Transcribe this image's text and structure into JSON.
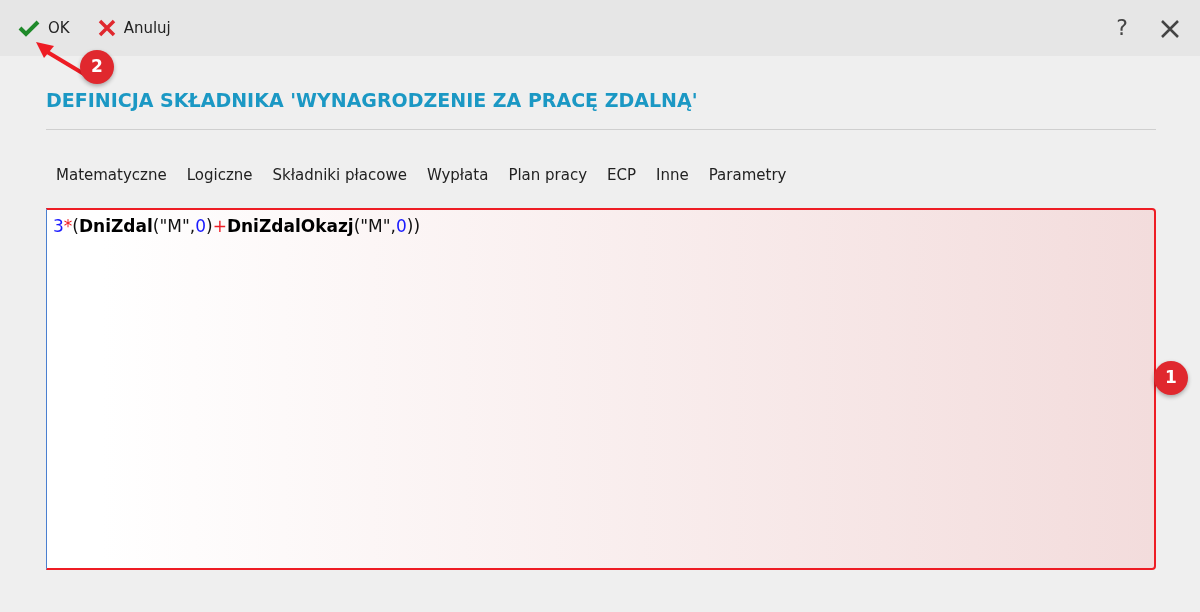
{
  "toolbar": {
    "buttons": [
      {
        "kind": "ok",
        "label": "OK"
      },
      {
        "kind": "cancel",
        "label": "Anuluj"
      }
    ],
    "icons": [
      {
        "kind": "help",
        "label": "?"
      },
      {
        "kind": "close"
      }
    ]
  },
  "title": "DEFINICJA SKŁADNIKA 'WYNAGRODZENIE ZA PRACĘ ZDALNĄ'",
  "tabs": [
    "Matematyczne",
    "Logiczne",
    "Składniki płacowe",
    "Wypłata",
    "Plan pracy",
    "ECP",
    "Inne",
    "Parametry"
  ],
  "formula": [
    {
      "kind": "number",
      "text": "3"
    },
    {
      "kind": "operator",
      "text": "*"
    },
    {
      "kind": "plain",
      "text": "("
    },
    {
      "kind": "function",
      "text": "DniZdal"
    },
    {
      "kind": "plain",
      "text": "(\"M\","
    },
    {
      "kind": "number",
      "text": "0"
    },
    {
      "kind": "plain",
      "text": ")"
    },
    {
      "kind": "operator",
      "text": "+"
    },
    {
      "kind": "function",
      "text": "DniZdalOkazj"
    },
    {
      "kind": "plain",
      "text": "(\"M\","
    },
    {
      "kind": "number",
      "text": "0"
    },
    {
      "kind": "plain",
      "text": "))"
    }
  ],
  "callouts": [
    {
      "label": "1",
      "kind": "badge"
    },
    {
      "label": "2",
      "kind": "arrow"
    }
  ]
}
